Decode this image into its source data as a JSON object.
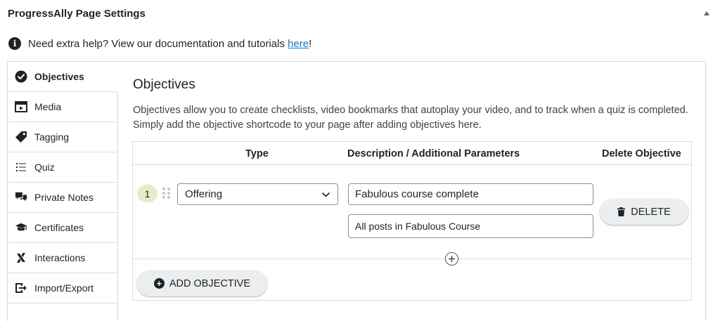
{
  "panel": {
    "title": "ProgressAlly Page Settings",
    "collapse_icon": "triangle-up-icon"
  },
  "help": {
    "text": "Need extra help? View our documentation and tutorials ",
    "link_text": "here",
    "suffix": "!",
    "icon": "info-icon"
  },
  "sidebar": {
    "items": [
      {
        "label": "Objectives",
        "icon": "check-circle-icon",
        "active": true
      },
      {
        "label": "Media",
        "icon": "film-icon"
      },
      {
        "label": "Tagging",
        "icon": "tag-icon"
      },
      {
        "label": "Quiz",
        "icon": "list-icon"
      },
      {
        "label": "Private Notes",
        "icon": "chat-bubbles-icon"
      },
      {
        "label": "Certificates",
        "icon": "graduation-cap-icon"
      },
      {
        "label": "Interactions",
        "icon": "x-icon"
      },
      {
        "label": "Import/Export",
        "icon": "export-icon"
      }
    ]
  },
  "main": {
    "title": "Objectives",
    "description": "Objectives allow you to create checklists, video bookmarks that autoplay your video, and to track when a quiz is completed. Simply add the objective shortcode to your page after adding objectives here.",
    "table": {
      "headers": {
        "type": "Type",
        "description": "Description / Additional Parameters",
        "delete": "Delete Objective"
      },
      "rows": [
        {
          "number": "1",
          "type": "Offering",
          "description": "Fabulous course complete",
          "parameter": "All posts in Fabulous Course",
          "delete_label": "DELETE"
        }
      ]
    },
    "add_button_label": "ADD OBJECTIVE"
  }
}
